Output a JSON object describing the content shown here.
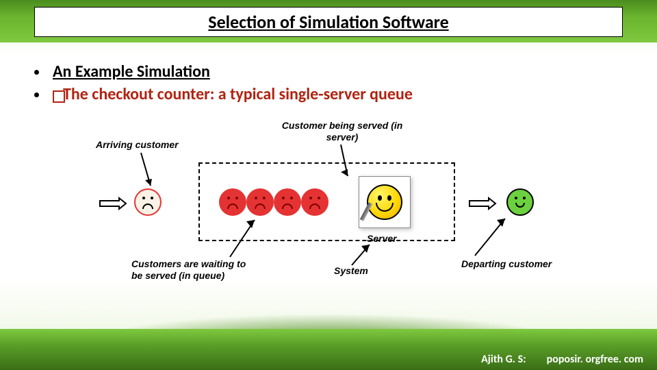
{
  "title": "Selection of Simulation Software",
  "bullets": {
    "b1": "An Example Simulation",
    "b2": "The checkout counter: a typical single-server queue"
  },
  "labels": {
    "arriving": "Arriving customer",
    "served": "Customer being served (in server)",
    "waiting": "Customers are waiting to be served (in queue)",
    "system": "System",
    "server": "Server",
    "departing": "Departing customer"
  },
  "footer": {
    "author": "Ajith G. S:",
    "url": "poposir. orgfree. com"
  },
  "icons": {
    "arrow": "arrow-right",
    "sad": "sad-face",
    "red": "angry-face",
    "happy": "happy-face",
    "smiley": "server-smiley"
  }
}
